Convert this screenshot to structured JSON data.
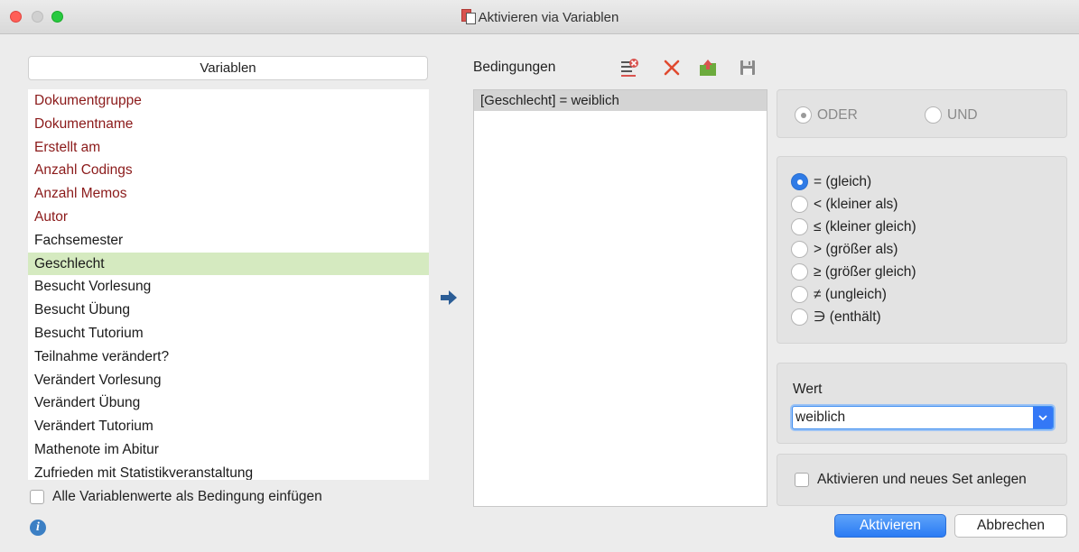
{
  "window": {
    "title": "Aktivieren via Variablen"
  },
  "variables": {
    "header": "Variablen",
    "items": [
      {
        "label": "Dokumentgruppe",
        "system": true
      },
      {
        "label": "Dokumentname",
        "system": true
      },
      {
        "label": "Erstellt am",
        "system": true
      },
      {
        "label": "Anzahl Codings",
        "system": true
      },
      {
        "label": "Anzahl Memos",
        "system": true
      },
      {
        "label": "Autor",
        "system": true
      },
      {
        "label": "Fachsemester",
        "system": false
      },
      {
        "label": "Geschlecht",
        "system": false,
        "selected": true
      },
      {
        "label": "Besucht Vorlesung",
        "system": false
      },
      {
        "label": "Besucht Übung",
        "system": false
      },
      {
        "label": "Besucht Tutorium",
        "system": false
      },
      {
        "label": "Teilnahme verändert?",
        "system": false
      },
      {
        "label": "Verändert Vorlesung",
        "system": false
      },
      {
        "label": "Verändert Übung",
        "system": false
      },
      {
        "label": "Verändert Tutorium",
        "system": false
      },
      {
        "label": "Mathenote im Abitur",
        "system": false
      },
      {
        "label": "Zufrieden mit Statistikveranstaltung",
        "system": false
      }
    ],
    "insert_all_label": "Alle Variablenwerte als Bedingung einfügen"
  },
  "conditions": {
    "label": "Bedingungen",
    "items": [
      "[Geschlecht] = weiblich"
    ],
    "toolbar_icons": [
      "clear-conditions-icon",
      "delete-icon",
      "open-icon",
      "save-icon"
    ]
  },
  "logic": {
    "oder": "ODER",
    "und": "UND",
    "selected": "ODER",
    "enabled": false
  },
  "operators": {
    "items": [
      "= (gleich)",
      "< (kleiner als)",
      "≤ (kleiner gleich)",
      "> (größer als)",
      "≥ (größer gleich)",
      "≠ (ungleich)",
      "∋ (enthält)"
    ],
    "selected_index": 0
  },
  "value": {
    "label": "Wert",
    "selected": "weiblich"
  },
  "create_set_label": "Aktivieren und neues Set anlegen",
  "buttons": {
    "activate": "Aktivieren",
    "cancel": "Abbrechen"
  },
  "colors": {
    "system_var": "#8b1a1a",
    "selection": "#d5eac0",
    "accent": "#2f7be6"
  }
}
